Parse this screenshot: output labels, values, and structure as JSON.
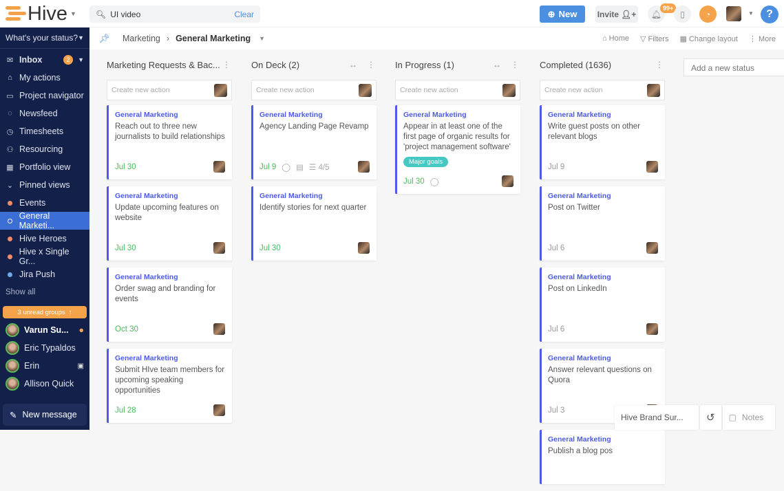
{
  "app": {
    "logo": "Hive",
    "search_value": "UI video",
    "search_clear": "Clear",
    "new_label": "New",
    "invite_label": "Invite",
    "notif_badge": "99+"
  },
  "sidebar": {
    "status": "What's your status?",
    "items": [
      {
        "label": "Inbox",
        "icon": "mail-icon",
        "badge": "2",
        "bold": true
      },
      {
        "label": "My actions",
        "icon": "home-icon"
      },
      {
        "label": "Project navigator",
        "icon": "folder-icon"
      },
      {
        "label": "Newsfeed",
        "icon": "chat-icon"
      },
      {
        "label": "Timesheets",
        "icon": "clock-icon"
      },
      {
        "label": "Resourcing",
        "icon": "people-icon"
      },
      {
        "label": "Portfolio view",
        "icon": "grid-icon"
      },
      {
        "label": "Pinned views",
        "icon": "chevron-down-icon"
      }
    ],
    "pinned": [
      {
        "label": "Events",
        "color": "#f08a6b"
      },
      {
        "label": "General Marketi...",
        "color": "#ffffff",
        "active": true
      },
      {
        "label": "Hive Heroes",
        "color": "#f08a6b"
      },
      {
        "label": "Hive x Single Gr...",
        "color": "#f08a6b"
      },
      {
        "label": "Jira Push",
        "color": "#6fa8e8"
      }
    ],
    "show_all": "Show all",
    "unread_groups": "3 unread groups",
    "people": [
      {
        "name": "Varun Su...",
        "bold": true
      },
      {
        "name": "Eric Typaldos"
      },
      {
        "name": "Erin"
      },
      {
        "name": "Allison Quick"
      }
    ],
    "new_message": "New message"
  },
  "breadcrumb": {
    "parent": "Marketing",
    "current": "General Marketing",
    "tools": [
      "Home",
      "Filters",
      "Change layout",
      "More"
    ]
  },
  "columns": [
    {
      "title": "Marketing Requests & Bac...",
      "create_placeholder": "Create new action",
      "expand": false,
      "cards": [
        {
          "project": "General Marketing",
          "title": "Reach out to three new journalists to build relationships",
          "date": "Jul 30"
        },
        {
          "project": "General Marketing",
          "title": "Update upcoming features on website",
          "date": "Jul 30"
        },
        {
          "project": "General Marketing",
          "title": "Order swag and branding for events",
          "date": "Oct 30"
        },
        {
          "project": "General Marketing",
          "title": "Submit HIve team members for upcoming speaking opportunities",
          "date": "Jul 28"
        }
      ]
    },
    {
      "title": "On Deck (2)",
      "create_placeholder": "Create new action",
      "expand": true,
      "cards": [
        {
          "project": "General Marketing",
          "title": "Agency Landing Page Revamp",
          "date": "Jul 9",
          "comment": true,
          "doc": true,
          "subtasks": "4/5"
        },
        {
          "project": "General Marketing",
          "title": "Identify stories for next quarter",
          "date": "Jul 30"
        }
      ]
    },
    {
      "title": "In Progress (1)",
      "create_placeholder": "Create new action",
      "expand": true,
      "cards": [
        {
          "project": "General Marketing",
          "title": "Appear in at least one of the first page of organic results for 'project management software'",
          "tag": "Major goals",
          "date": "Jul 30",
          "comment": true
        }
      ]
    },
    {
      "title": "Completed (1636)",
      "create_placeholder": "Create new action",
      "expand": false,
      "done": true,
      "cards": [
        {
          "project": "General Marketing",
          "title": "Write guest posts on other relevant blogs",
          "date": "Jul 9"
        },
        {
          "project": "General Marketing",
          "title": "Post on Twitter",
          "date": "Jul 6"
        },
        {
          "project": "General Marketing",
          "title": "Post on LinkedIn",
          "date": "Jul 6"
        },
        {
          "project": "General Marketing",
          "title": "Answer relevant questions on Quora",
          "date": "Jul 3"
        },
        {
          "project": "General Marketing",
          "title": "Publish a blog pos",
          "date": ""
        }
      ]
    }
  ],
  "add_status_placeholder": "Add a new status",
  "bottom": {
    "doc": "Hive Brand Sur...",
    "notes": "Notes"
  }
}
